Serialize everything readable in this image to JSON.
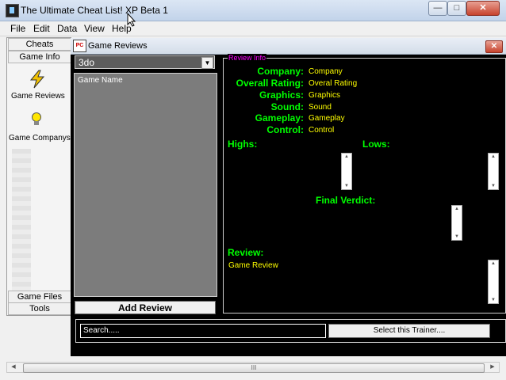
{
  "window": {
    "title": "The Ultimate Cheat List! XP Beta 1",
    "minimize": "—",
    "maximize": "□",
    "close": "✕"
  },
  "menu": [
    "File",
    "Edit",
    "Data",
    "View",
    "Help"
  ],
  "left_panel": {
    "tab_top": "Cheats",
    "tab_second": "Game Info",
    "nav": [
      {
        "label": "Game Reviews",
        "icon": "lightning-icon"
      },
      {
        "label": "Game Companys",
        "icon": "lightbulb-icon"
      }
    ],
    "tab_game_files": "Game Files",
    "tab_tools": "Tools"
  },
  "child_window": {
    "title": "Game Reviews",
    "close": "✕",
    "dropdown_value": "3do",
    "list_header": "Game Name",
    "add_review": "Add Review",
    "review_legend": "Review Info",
    "fields": [
      {
        "label": "Company:",
        "value": "Company"
      },
      {
        "label": "Overall Rating:",
        "value": "Overal Rating"
      },
      {
        "label": "Graphics:",
        "value": "Graphics"
      },
      {
        "label": "Sound:",
        "value": "Sound"
      },
      {
        "label": "Gameplay:",
        "value": "Gameplay"
      },
      {
        "label": "Control:",
        "value": "Control"
      }
    ],
    "highs": "Highs:",
    "lows": "Lows:",
    "final_verdict": "Final Verdict:",
    "review": "Review:",
    "review_value": "Game Review",
    "search_placeholder": "Search.....",
    "select_trainer": "Select this Trainer...."
  },
  "hscroll_grip": "III",
  "colors": {
    "label": "#00ff00",
    "value": "#ffff00",
    "legend": "#ff00ff",
    "background": "#000000"
  }
}
